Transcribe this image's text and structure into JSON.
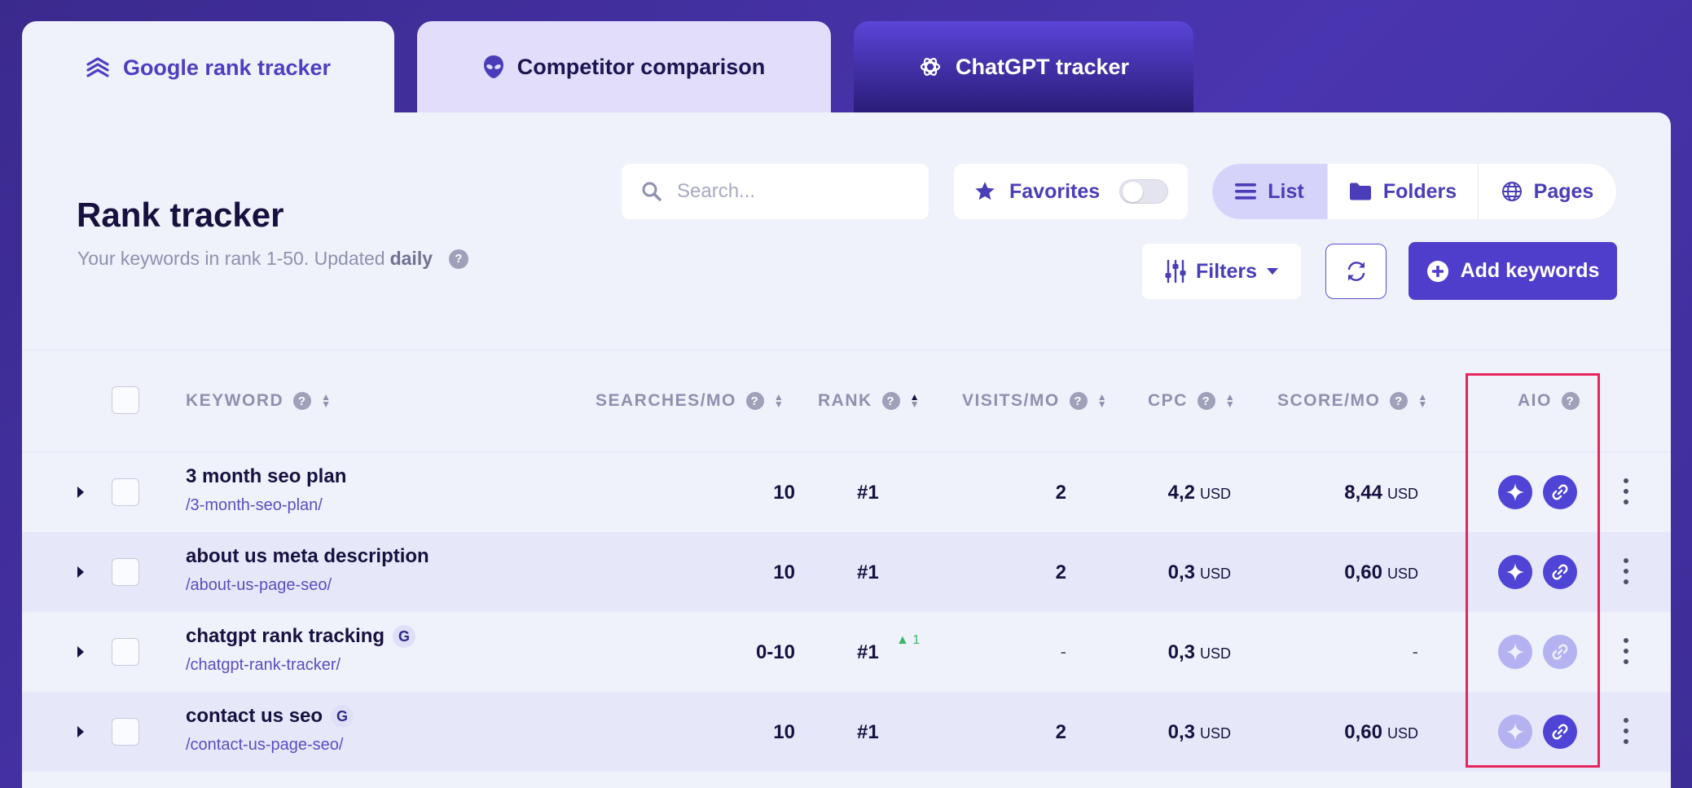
{
  "tabs": [
    {
      "label": "Google rank tracker",
      "icon": "stack-layers-icon"
    },
    {
      "label": "Competitor comparison",
      "icon": "alien-head-icon"
    },
    {
      "label": "ChatGPT tracker",
      "icon": "openai-logo-icon"
    }
  ],
  "header": {
    "title": "Rank tracker",
    "subtitle_prefix": "Your keywords in rank 1-50. Updated",
    "subtitle_bold": "daily",
    "help": "?"
  },
  "toolbar": {
    "search_placeholder": "Search...",
    "favorites_label": "Favorites",
    "favorites_on": false,
    "views": [
      "List",
      "Folders",
      "Pages"
    ],
    "active_view": "List",
    "filters_label": "Filters",
    "add_keywords_label": "Add keywords"
  },
  "table": {
    "columns": {
      "keyword": "KEYWORD",
      "searches": "SEARCHES/MO",
      "rank": "RANK",
      "visits": "VISITS/MO",
      "cpc": "CPC",
      "score": "SCORE/MO",
      "aio": "AIO"
    },
    "rows": [
      {
        "keyword": "3 month seo plan",
        "url": "/3-month-seo-plan/",
        "g_badge": "",
        "searches": "10",
        "rank": "#1",
        "rank_change": "",
        "visits": "2",
        "cpc": "4,2",
        "cpc_unit": "USD",
        "score": "8,44",
        "score_unit": "USD",
        "aio_spark": true,
        "aio_link": true
      },
      {
        "keyword": "about us meta description",
        "url": "/about-us-page-seo/",
        "g_badge": "",
        "searches": "10",
        "rank": "#1",
        "rank_change": "",
        "visits": "2",
        "cpc": "0,3",
        "cpc_unit": "USD",
        "score": "0,60",
        "score_unit": "USD",
        "aio_spark": true,
        "aio_link": true
      },
      {
        "keyword": "chatgpt rank tracking",
        "url": "/chatgpt-rank-tracker/",
        "g_badge": "G",
        "searches": "0-10",
        "rank": "#1",
        "rank_change": "1",
        "visits": "-",
        "cpc": "0,3",
        "cpc_unit": "USD",
        "score": "-",
        "score_unit": "",
        "aio_spark": false,
        "aio_link": false
      },
      {
        "keyword": "contact us seo",
        "url": "/contact-us-page-seo/",
        "g_badge": "G",
        "searches": "10",
        "rank": "#1",
        "rank_change": "",
        "visits": "2",
        "cpc": "0,3",
        "cpc_unit": "USD",
        "score": "0,60",
        "score_unit": "USD",
        "aio_spark": false,
        "aio_link": true
      }
    ]
  },
  "colors": {
    "brand": "#4f3dcb",
    "background": "#3b2a8e",
    "panel": "#eff1fb",
    "highlight": "#e8245c",
    "rank_up": "#3ab86a"
  }
}
